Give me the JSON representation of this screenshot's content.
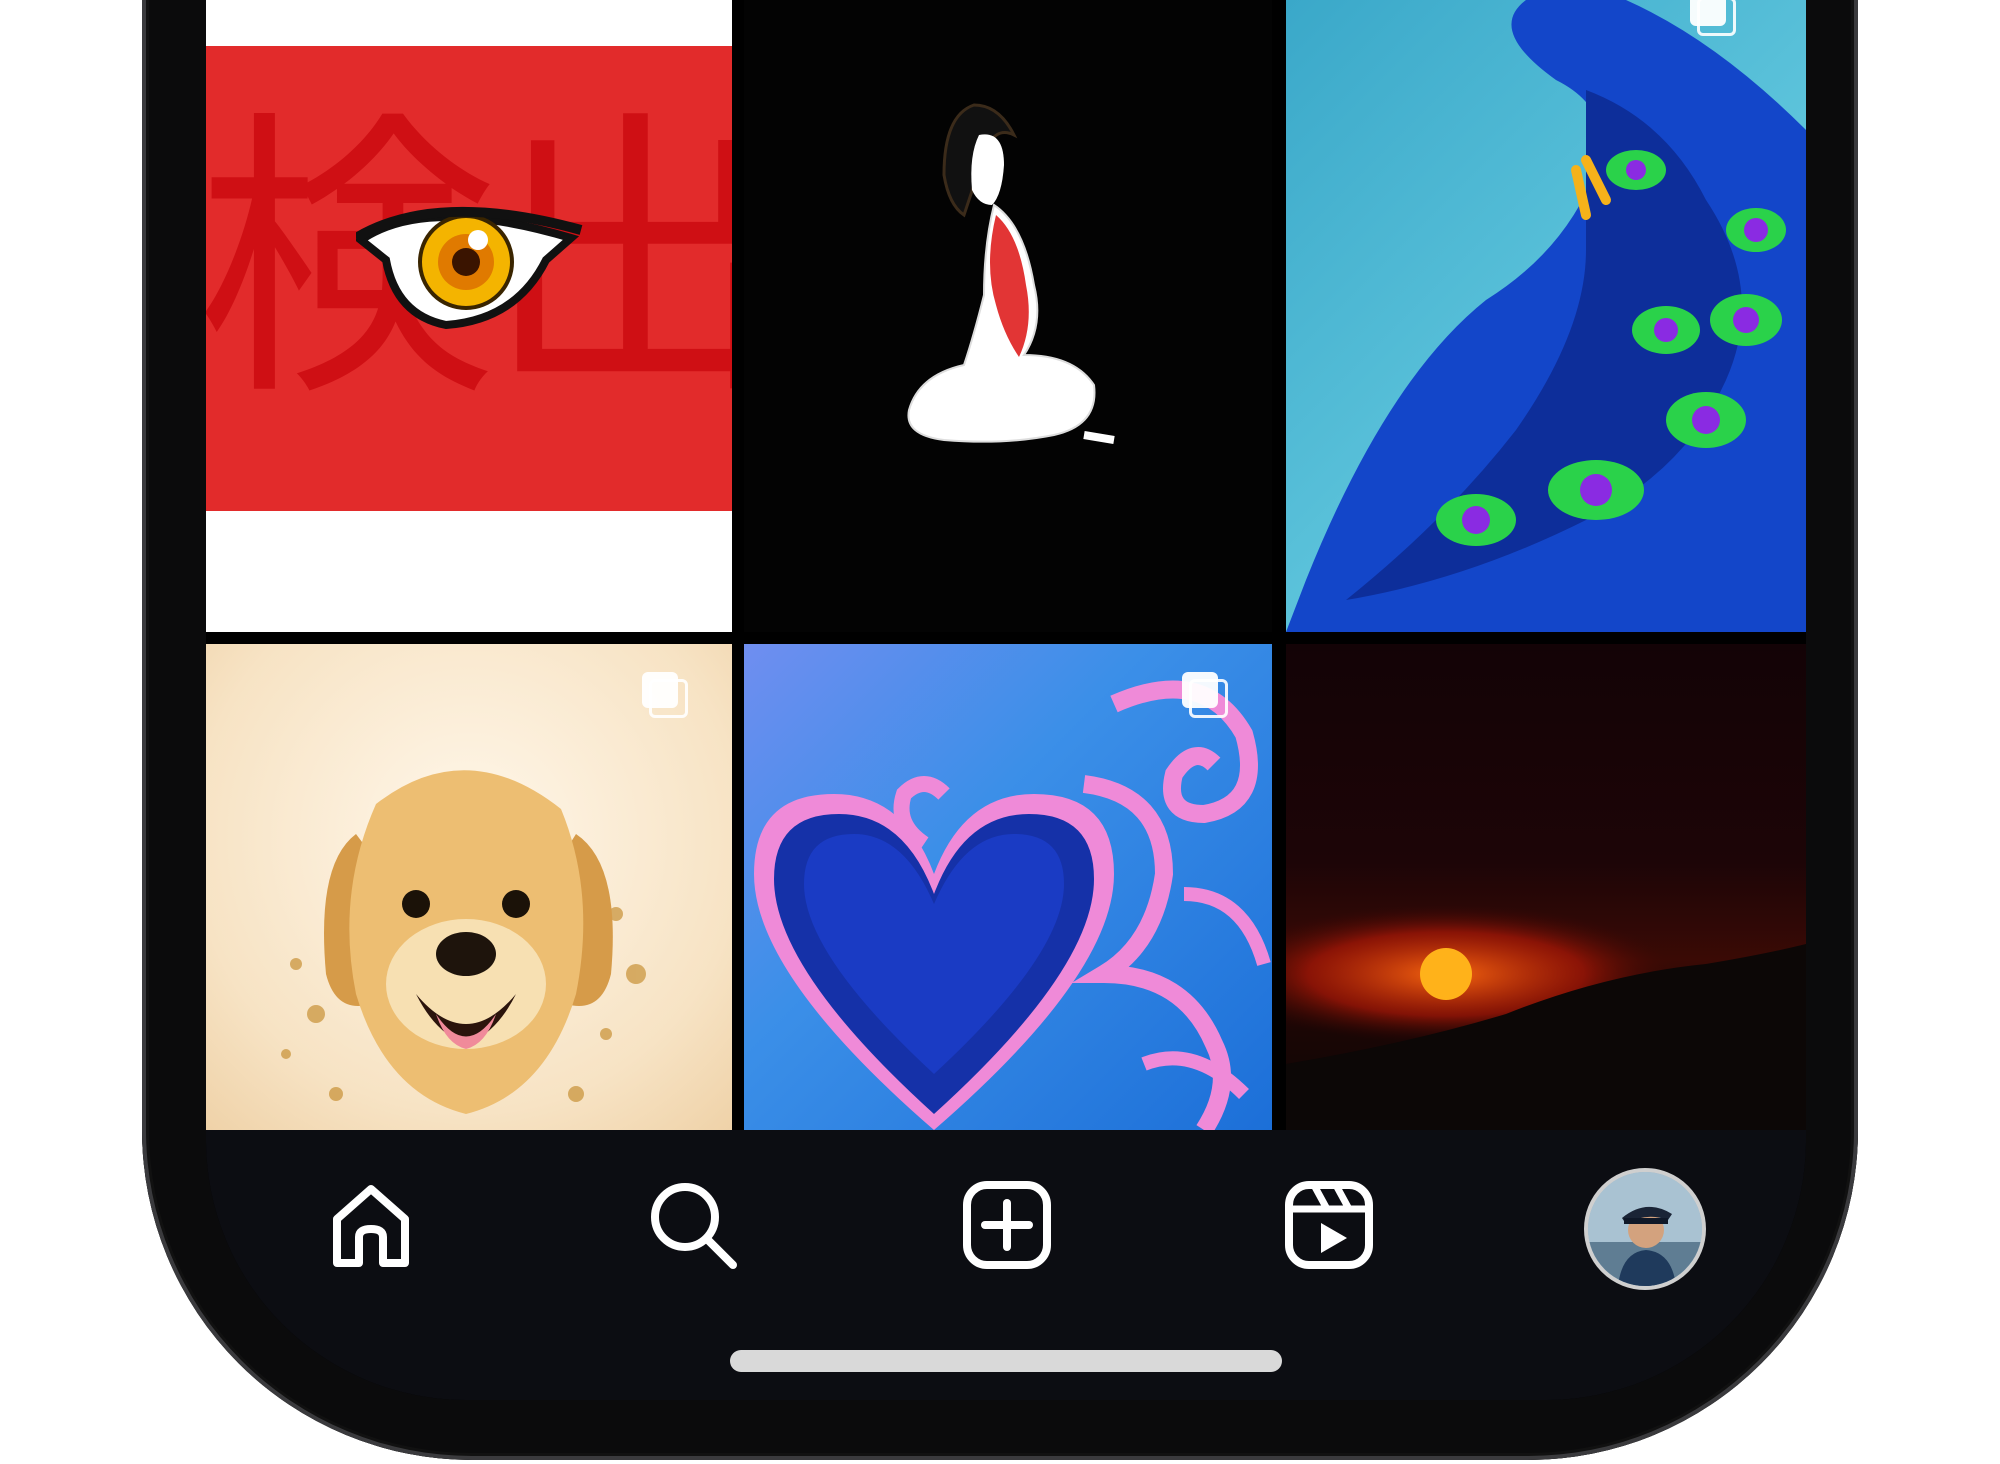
{
  "grid": {
    "tiles": [
      {
        "id": "eye-kanji",
        "text": "検出",
        "multi": false
      },
      {
        "id": "woman-silhouette",
        "multi": false
      },
      {
        "id": "peacock",
        "multi": true
      },
      {
        "id": "puppy",
        "multi": true
      },
      {
        "id": "blue-heart",
        "multi": true
      },
      {
        "id": "sunset",
        "multi": false
      }
    ]
  },
  "nav": {
    "items": [
      {
        "name": "home",
        "icon": "home-icon"
      },
      {
        "name": "search",
        "icon": "search-icon"
      },
      {
        "name": "create",
        "icon": "plus-square-icon"
      },
      {
        "name": "reels",
        "icon": "reels-icon"
      },
      {
        "name": "profile",
        "icon": "avatar"
      }
    ]
  },
  "colors": {
    "navbar_bg": "#0c0d12",
    "kanji_red": "#e02a2a",
    "icon": "#ffffff"
  }
}
